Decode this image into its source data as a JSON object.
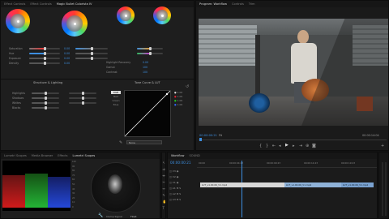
{
  "left_panel": {
    "tabs": [
      {
        "label": "Effect Controls"
      },
      {
        "label": "Effect Controls"
      },
      {
        "label": "Magic Bullet Colorista IV"
      }
    ],
    "sliders_top": [
      {
        "label": "Saturation",
        "value": "0.00",
        "fill": 0.5
      },
      {
        "label": "Hue",
        "value": "0.00",
        "fill": 0.5
      },
      {
        "label": "Exposure",
        "value": "0.00",
        "fill": 0.5
      },
      {
        "label": "Density",
        "value": "0.00",
        "fill": 0.5
      }
    ],
    "sliders_right": [
      {
        "label": "Highlight Recovery",
        "value": "0.00"
      },
      {
        "label": "Gamut",
        "value": "100"
      },
      {
        "label": "Contrast",
        "value": "100"
      }
    ],
    "section_structure": "Structure & Lighting",
    "structure_sliders": [
      {
        "label": "Highlights",
        "fill": 0.5
      },
      {
        "label": "Shadows",
        "fill": 0.5
      },
      {
        "label": "Whites",
        "fill": 0.5
      },
      {
        "label": "Blacks",
        "fill": 0.5
      }
    ],
    "section_curve": "Tone Curve & LUT",
    "curve_options": [
      "RGB",
      "Red",
      "Green",
      "Blue"
    ],
    "curve_values": [
      "1.00",
      "1.00",
      "1.00",
      "1.00"
    ],
    "lut_select": "None"
  },
  "program_monitor": {
    "tabs": [
      {
        "label": "Program: Workflow"
      },
      {
        "label": "Controls"
      },
      {
        "label": "Trim"
      }
    ],
    "timecode": "00:00:00:21",
    "zoom": "Fit",
    "duration": "00:00:14:04"
  },
  "scopes": {
    "tabs": [
      {
        "label": "Lumetri Scopes"
      },
      {
        "label": "Media Browser"
      },
      {
        "label": "Effects"
      },
      {
        "label": "Lumetri Scopes"
      }
    ],
    "scale_labels": [
      "100",
      "90",
      "80",
      "70",
      "60",
      "50",
      "40",
      "30",
      "20",
      "10",
      "0"
    ],
    "footer_clamp": "Clamp Signal",
    "footer_mode": "Float"
  },
  "timeline": {
    "tabs": [
      {
        "label": "Workflow"
      },
      {
        "label": "SOUND"
      }
    ],
    "timecode": "00:00:00:21",
    "ruler": [
      "00:00",
      "00:00:04:23",
      "00:00:09:23",
      "00:00:14:23",
      "00:00:19:23"
    ],
    "tracks": [
      "V3",
      "V2",
      "V1",
      "A1",
      "A2",
      "A3"
    ],
    "clips": [
      {
        "label": "LUT_v1.00.06_V1.mp4"
      },
      {
        "label": "LUT_v1.00.06_V1.mp4"
      },
      {
        "label": "LUT_v1.00.06_V1.mp4"
      }
    ]
  }
}
